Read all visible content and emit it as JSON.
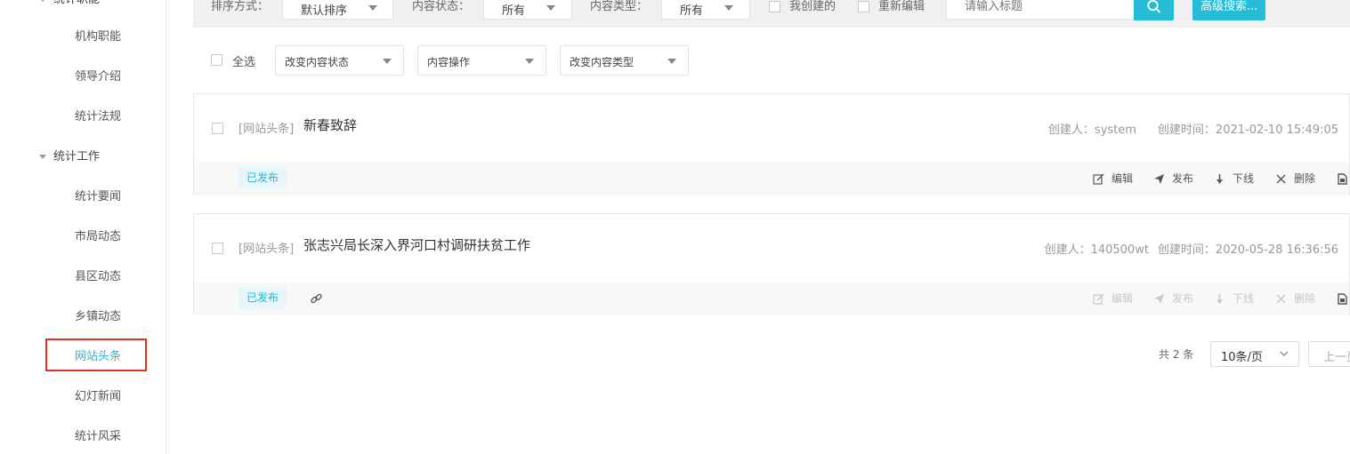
{
  "sidebar": {
    "top_partial": "统计职能",
    "items_a": [
      "机构职能",
      "领导介绍",
      "统计法规"
    ],
    "group": "统计工作",
    "items_b": [
      "统计要闻",
      "市局动态",
      "县区动态",
      "乡镇动态",
      "网站头条",
      "幻灯新闻",
      "统计风采"
    ],
    "active": "网站头条"
  },
  "filters": {
    "sort_label": "排序方式：",
    "sort_value": "默认排序",
    "status_label": "内容状态：",
    "status_value": "所有",
    "type_label": "内容类型：",
    "type_value": "所有",
    "created_by_me": "我创建的",
    "re_edit": "重新编辑",
    "search_placeholder": "请输入标题",
    "advanced_search": "高级搜索..."
  },
  "batch": {
    "select_all": "全选",
    "change_status": "改变内容状态",
    "content_ops": "内容操作",
    "change_type": "改变内容类型"
  },
  "items": [
    {
      "tag": "[网站头条]",
      "title": "新春致辞",
      "creator": "创建人：system",
      "created": "创建时间：2021-02-10 15:49:05",
      "status": "已发布"
    },
    {
      "tag": "[网站头条]",
      "title": "张志兴局长深入界河口村调研扶贫工作",
      "creator": "创建人：140500wt",
      "created": "创建时间：2020-05-28 16:36:56",
      "status": "已发布"
    }
  ],
  "actions": {
    "edit": "编辑",
    "publish": "发布",
    "offline": "下线",
    "delete": "删除"
  },
  "pagination": {
    "total": "共 2 条",
    "page_size": "10条/页",
    "prev": "上一页"
  },
  "colors": {
    "accent": "#26bcd7",
    "highlight_border": "#e0312b"
  }
}
